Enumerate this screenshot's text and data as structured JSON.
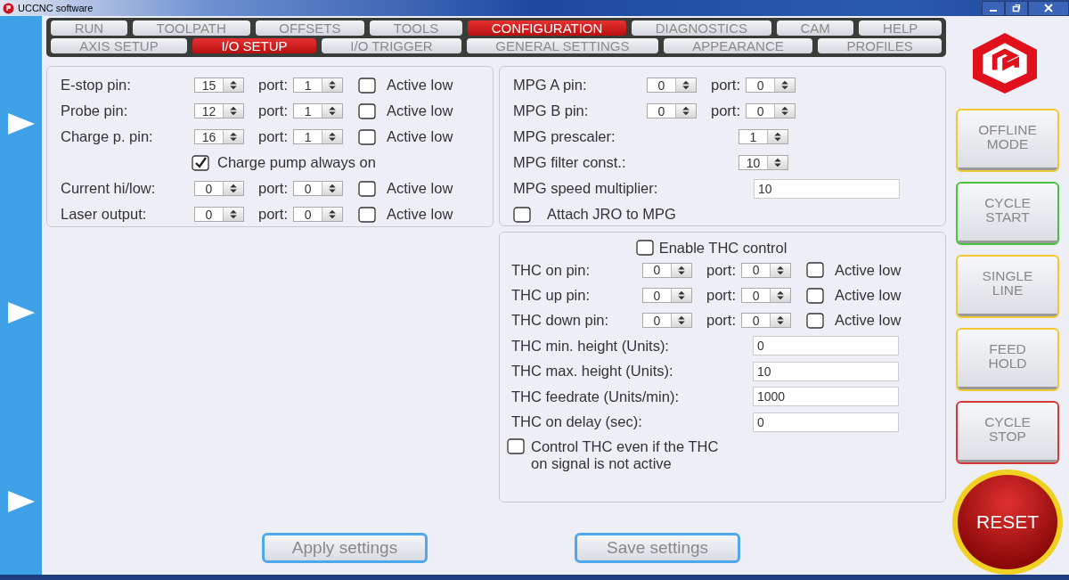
{
  "window": {
    "title": "UCCNC software"
  },
  "menu_tabs": [
    {
      "label": "RUN",
      "selected": false
    },
    {
      "label": "TOOLPATH",
      "selected": false
    },
    {
      "label": "OFFSETS",
      "selected": false
    },
    {
      "label": "TOOLS",
      "selected": false
    },
    {
      "label": "CONFIGURATION",
      "selected": true
    },
    {
      "label": "DIAGNOSTICS",
      "selected": false
    },
    {
      "label": "CAM",
      "selected": false
    },
    {
      "label": "HELP",
      "selected": false
    }
  ],
  "sub_tabs": [
    {
      "label": "AXIS SETUP",
      "selected": false
    },
    {
      "label": "I/O SETUP",
      "selected": true
    },
    {
      "label": "I/O  TRIGGER",
      "selected": false
    },
    {
      "label": "GENERAL SETTINGS",
      "selected": false
    },
    {
      "label": "APPEARANCE",
      "selected": false
    },
    {
      "label": "PROFILES",
      "selected": false
    }
  ],
  "io_panel": {
    "rows": [
      {
        "kind": "pin",
        "label": "E-stop pin:",
        "pin": "15",
        "port_label": "port:",
        "port": "1",
        "check_label": "Active low",
        "checked": false
      },
      {
        "kind": "pin",
        "label": "Probe pin:",
        "pin": "12",
        "port_label": "port:",
        "port": "1",
        "check_label": "Active low",
        "checked": false
      },
      {
        "kind": "pin",
        "label": "Charge p. pin:",
        "pin": "16",
        "port_label": "port:",
        "port": "1",
        "check_label": "Active low",
        "checked": false
      },
      {
        "kind": "check",
        "label": "Charge pump always on",
        "checked": true
      },
      {
        "kind": "pin",
        "label": "Current hi/low:",
        "pin": "0",
        "port_label": "port:",
        "port": "0",
        "check_label": "Active low",
        "checked": false
      },
      {
        "kind": "pin",
        "label": "Laser output:",
        "pin": "0",
        "port_label": "port:",
        "port": "0",
        "check_label": "Active low",
        "checked": false
      }
    ]
  },
  "mpg_panel": {
    "rows": [
      {
        "kind": "pin",
        "label": "MPG A pin:",
        "pin": "0",
        "port_label": "port:",
        "port": "0"
      },
      {
        "kind": "pin",
        "label": "MPG B pin:",
        "pin": "0",
        "port_label": "port:",
        "port": "0"
      },
      {
        "kind": "spin",
        "label": "MPG prescaler:",
        "value": "1"
      },
      {
        "kind": "spin",
        "label": "MPG filter const.:",
        "value": "10"
      },
      {
        "kind": "text",
        "label": "MPG speed multiplier:",
        "value": "10"
      },
      {
        "kind": "check",
        "label": "Attach JRO to MPG",
        "checked": false
      }
    ]
  },
  "thc_panel": {
    "enable": {
      "label": "Enable THC control",
      "checked": false
    },
    "rows": [
      {
        "kind": "pin",
        "label": "THC on pin:",
        "pin": "0",
        "port_label": "port:",
        "port": "0",
        "check_label": "Active low",
        "checked": false
      },
      {
        "kind": "pin",
        "label": "THC up pin:",
        "pin": "0",
        "port_label": "port:",
        "port": "0",
        "check_label": "Active low",
        "checked": false
      },
      {
        "kind": "pin",
        "label": "THC down pin:",
        "pin": "0",
        "port_label": "port:",
        "port": "0",
        "check_label": "Active low",
        "checked": false
      },
      {
        "kind": "text",
        "label": "THC min. height (Units):",
        "value": "0"
      },
      {
        "kind": "text",
        "label": "THC max. height (Units):",
        "value": "10"
      },
      {
        "kind": "text",
        "label": "THC feedrate (Units/min):",
        "value": "1000"
      },
      {
        "kind": "text",
        "label": "THC on delay (sec):",
        "value": "0"
      },
      {
        "kind": "check",
        "label": "Control THC even if the THC on signal is not active",
        "checked": false
      }
    ]
  },
  "buttons": [
    {
      "label": "Apply settings"
    },
    {
      "label": "Save settings"
    }
  ],
  "side_buttons": [
    {
      "label": "OFFLINE MODE",
      "color": "#f0c832"
    },
    {
      "label": "CYCLE START",
      "color": "#4cc040"
    },
    {
      "label": "SINGLE LINE",
      "color": "#f0c832"
    },
    {
      "label": "FEED HOLD",
      "color": "#f0c832"
    },
    {
      "label": "CYCLE STOP",
      "color": "#d83838"
    }
  ],
  "reset_button": {
    "label": "RESET"
  }
}
